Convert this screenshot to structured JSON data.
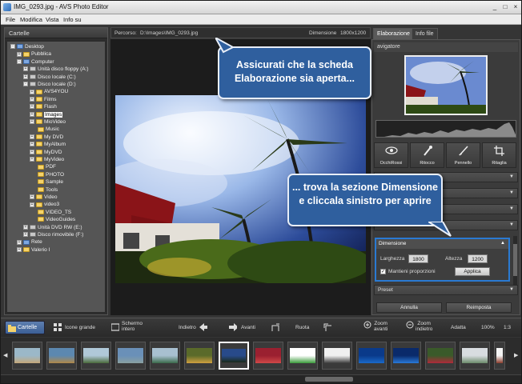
{
  "window": {
    "title": "IMG_0293.jpg  -  AVS Photo Editor",
    "minimize": "_",
    "maximize": "□",
    "close": "×"
  },
  "menu": [
    "File",
    "Modifica",
    "Vista",
    "Info su"
  ],
  "folders": {
    "header": "Cartelle",
    "tree": [
      {
        "label": "Desktop",
        "exp": "-",
        "icon": "folder-blue",
        "sel": false
      },
      {
        "label": "Pubblica",
        "exp": "+",
        "icon": "folder",
        "sel": false
      },
      {
        "label": "Computer",
        "exp": "-",
        "icon": "folder-blue",
        "sel": false
      },
      {
        "label": "Unità disco floppy (A:)",
        "exp": "+",
        "icon": "drive",
        "sel": false
      },
      {
        "label": "Disco locale (C:)",
        "exp": "+",
        "icon": "drive",
        "sel": false
      },
      {
        "label": "Disco locale (D:)",
        "exp": "-",
        "icon": "drive",
        "sel": false
      },
      {
        "label": "AVS4YOU",
        "exp": "+",
        "icon": "folder",
        "sel": false
      },
      {
        "label": "Films",
        "exp": "+",
        "icon": "folder",
        "sel": false
      },
      {
        "label": "Flash",
        "exp": "+",
        "icon": "folder",
        "sel": false
      },
      {
        "label": "Images",
        "exp": "+",
        "icon": "folder",
        "sel": true
      },
      {
        "label": "MioVideo",
        "exp": "+",
        "icon": "folder",
        "sel": false
      },
      {
        "label": "Music",
        "exp": "",
        "icon": "folder",
        "sel": false
      },
      {
        "label": "My DVD",
        "exp": "+",
        "icon": "folder",
        "sel": false
      },
      {
        "label": "MyAlbum",
        "exp": "+",
        "icon": "folder",
        "sel": false
      },
      {
        "label": "MyDVD",
        "exp": "+",
        "icon": "folder",
        "sel": false
      },
      {
        "label": "MyVideo",
        "exp": "+",
        "icon": "folder",
        "sel": false
      },
      {
        "label": "PDF",
        "exp": "",
        "icon": "folder",
        "sel": false
      },
      {
        "label": "PHOTO",
        "exp": "",
        "icon": "folder",
        "sel": false
      },
      {
        "label": "Sample",
        "exp": "",
        "icon": "folder",
        "sel": false
      },
      {
        "label": "Tools",
        "exp": "",
        "icon": "folder",
        "sel": false
      },
      {
        "label": "Video",
        "exp": "+",
        "icon": "folder",
        "sel": false
      },
      {
        "label": "video3",
        "exp": "+",
        "icon": "folder",
        "sel": false
      },
      {
        "label": "VIDEO_TS",
        "exp": "",
        "icon": "folder",
        "sel": false
      },
      {
        "label": "VideoGuides",
        "exp": "",
        "icon": "folder",
        "sel": false
      },
      {
        "label": "Unità DVD RW (E:)",
        "exp": "+",
        "icon": "drive",
        "sel": false
      },
      {
        "label": "Disco rimovibile (F:)",
        "exp": "+",
        "icon": "drive",
        "sel": false
      },
      {
        "label": "Rete",
        "exp": "+",
        "icon": "folder-blue",
        "sel": false
      },
      {
        "label": "Valerio I",
        "exp": "+",
        "icon": "folder",
        "sel": false
      }
    ]
  },
  "pathbar": {
    "path_label": "Percorso:",
    "path_value": "D:\\Images\\IMG_0293.jpg",
    "dim_label": "Dimensione",
    "dim_value": "1800x1200"
  },
  "tabs": [
    "Elaborazione",
    "Info file"
  ],
  "right": {
    "navigator_label": "avigatore",
    "tools": [
      "OcchiRossi",
      "Ritocco",
      "Pennello",
      "Ritaglia"
    ],
    "dimension": {
      "header": "Dimensione",
      "width_label": "Larghezza",
      "width_value": "1800",
      "height_label": "Altezza",
      "height_value": "1200",
      "keep_ratio_label": "Mantieni proporzioni",
      "keep_ratio_checked": "✓",
      "apply_label": "Applica"
    },
    "preset_label": "Preset",
    "cancel_label": "Annulla",
    "reset_label": "Reimposta"
  },
  "callouts": {
    "top": "Assicurati che la scheda Elaborazione sia aperta...",
    "bottom": "... trova la sezione Dimensione e cliccala sinistro per aprire"
  },
  "toolbar": {
    "folders": "Cartelle",
    "large_icons": "Icone grande",
    "fullscreen_1": "Schermo",
    "fullscreen_2": "intero",
    "back": "Indietro",
    "forward": "Avanti",
    "rotate": "Ruota",
    "zoom_in_1": "Zoom",
    "zoom_in_2": "avanti",
    "zoom_out_1": "Zoom",
    "zoom_out_2": "indietro",
    "fit": "Adatta",
    "zoom_pct": "100%",
    "ratio": "1:3"
  },
  "filmstrip": {
    "thumbs": [
      {
        "c1": "#9bb8c8",
        "c2": "#c4a87a"
      },
      {
        "c1": "#5c88b0",
        "c2": "#b08848"
      },
      {
        "c1": "#b0c8d8",
        "c2": "#4a6a3a"
      },
      {
        "c1": "#6a90b8",
        "c2": "#8aa0a0"
      },
      {
        "c1": "#a8c0d0",
        "c2": "#3a6a4a"
      },
      {
        "c1": "#5a6a2a",
        "c2": "#d0a040"
      },
      {
        "c1": "#284a8a",
        "c2": "#1a2a1a"
      },
      {
        "c1": "#9a2030",
        "c2": "#d04848"
      },
      {
        "c1": "#ffffff",
        "c2": "#3a9a3a"
      },
      {
        "c1": "#f0f0f0",
        "c2": "#3a3a3a"
      },
      {
        "c1": "#0a3a8a",
        "c2": "#1a6aca"
      },
      {
        "c1": "#0a2a6a",
        "c2": "#2a7ada"
      },
      {
        "c1": "#3a5a2a",
        "c2": "#b02a3a"
      },
      {
        "c1": "#d8dce0",
        "c2": "#6a8a6a"
      },
      {
        "c1": "#f4f4f4",
        "c2": "#8a3a2a"
      }
    ]
  }
}
